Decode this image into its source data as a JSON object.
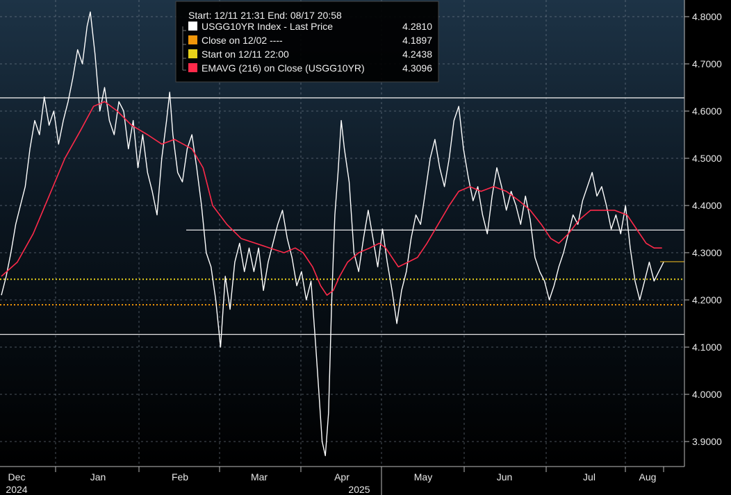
{
  "chart_data": {
    "type": "line",
    "header": "Start: 12/11 21:31 End: 08/17 20:58",
    "x_labels": [
      {
        "month": "Dec",
        "year": "2024"
      },
      {
        "month": "Jan",
        "year": ""
      },
      {
        "month": "Feb",
        "year": ""
      },
      {
        "month": "Mar",
        "year": ""
      },
      {
        "month": "Apr",
        "year": "2025"
      },
      {
        "month": "May",
        "year": ""
      },
      {
        "month": "Jun",
        "year": ""
      },
      {
        "month": "Jul",
        "year": ""
      },
      {
        "month": "Aug",
        "year": ""
      }
    ],
    "y_ticks": [
      "4.8000",
      "4.7000",
      "4.6000",
      "4.5000",
      "4.4000",
      "4.3000",
      "4.2000",
      "4.1000",
      "4.0000",
      "3.9000"
    ],
    "ylim": [
      3.85,
      4.82
    ],
    "legend": [
      {
        "label": "USGG10YR Index - Last Price",
        "value": "4.2810",
        "color": "#ffffff"
      },
      {
        "label": "Close on 12/02 ----",
        "value": "4.1897",
        "color": "#f0960a"
      },
      {
        "label": "Start on 12/11 22:00",
        "value": "4.2438",
        "color": "#e8d21a"
      },
      {
        "label": "EMAVG (216)  on Close (USGG10YR)",
        "value": "4.3096",
        "color": "#ff2a4a"
      }
    ],
    "reference_lines": {
      "horizontal": [
        4.628,
        4.348,
        4.127
      ],
      "close_line": 4.1897,
      "start_line": 4.2438,
      "last_marker": 4.281
    },
    "series": [
      {
        "name": "USGG10YR Index - Last Price",
        "points": [
          [
            0,
            4.21
          ],
          [
            0.3,
            4.25
          ],
          [
            0.6,
            4.3
          ],
          [
            0.9,
            4.36
          ],
          [
            1.2,
            4.4
          ],
          [
            1.5,
            4.44
          ],
          [
            1.8,
            4.52
          ],
          [
            2.1,
            4.58
          ],
          [
            2.4,
            4.55
          ],
          [
            2.7,
            4.63
          ],
          [
            3.0,
            4.57
          ],
          [
            3.3,
            4.6
          ],
          [
            3.6,
            4.53
          ],
          [
            3.9,
            4.58
          ],
          [
            4.2,
            4.62
          ],
          [
            4.5,
            4.67
          ],
          [
            4.8,
            4.73
          ],
          [
            5.1,
            4.7
          ],
          [
            5.4,
            4.78
          ],
          [
            5.6,
            4.81
          ],
          [
            5.9,
            4.72
          ],
          [
            6.2,
            4.6
          ],
          [
            6.5,
            4.65
          ],
          [
            6.8,
            4.58
          ],
          [
            7.1,
            4.55
          ],
          [
            7.4,
            4.62
          ],
          [
            7.7,
            4.6
          ],
          [
            8.0,
            4.52
          ],
          [
            8.3,
            4.58
          ],
          [
            8.6,
            4.48
          ],
          [
            8.9,
            4.55
          ],
          [
            9.2,
            4.47
          ],
          [
            9.5,
            4.43
          ],
          [
            9.8,
            4.38
          ],
          [
            10.1,
            4.5
          ],
          [
            10.4,
            4.58
          ],
          [
            10.6,
            4.64
          ],
          [
            10.8,
            4.55
          ],
          [
            11.1,
            4.47
          ],
          [
            11.4,
            4.45
          ],
          [
            11.7,
            4.52
          ],
          [
            12.0,
            4.55
          ],
          [
            12.3,
            4.48
          ],
          [
            12.6,
            4.4
          ],
          [
            12.9,
            4.3
          ],
          [
            13.2,
            4.27
          ],
          [
            13.5,
            4.2
          ],
          [
            13.8,
            4.1
          ],
          [
            14.1,
            4.25
          ],
          [
            14.4,
            4.18
          ],
          [
            14.7,
            4.28
          ],
          [
            15.0,
            4.32
          ],
          [
            15.3,
            4.26
          ],
          [
            15.6,
            4.31
          ],
          [
            15.9,
            4.26
          ],
          [
            16.2,
            4.31
          ],
          [
            16.5,
            4.22
          ],
          [
            16.8,
            4.28
          ],
          [
            17.1,
            4.32
          ],
          [
            17.4,
            4.36
          ],
          [
            17.7,
            4.39
          ],
          [
            18.0,
            4.33
          ],
          [
            18.3,
            4.29
          ],
          [
            18.6,
            4.23
          ],
          [
            18.9,
            4.26
          ],
          [
            19.2,
            4.2
          ],
          [
            19.5,
            4.24
          ],
          [
            19.8,
            4.1
          ],
          [
            20.0,
            4.0
          ],
          [
            20.2,
            3.9
          ],
          [
            20.4,
            3.87
          ],
          [
            20.6,
            3.96
          ],
          [
            20.8,
            4.2
          ],
          [
            21.0,
            4.38
          ],
          [
            21.2,
            4.47
          ],
          [
            21.4,
            4.58
          ],
          [
            21.6,
            4.52
          ],
          [
            21.9,
            4.45
          ],
          [
            22.2,
            4.3
          ],
          [
            22.5,
            4.26
          ],
          [
            22.8,
            4.33
          ],
          [
            23.1,
            4.39
          ],
          [
            23.4,
            4.33
          ],
          [
            23.7,
            4.27
          ],
          [
            24.0,
            4.35
          ],
          [
            24.3,
            4.28
          ],
          [
            24.6,
            4.22
          ],
          [
            24.9,
            4.15
          ],
          [
            25.2,
            4.22
          ],
          [
            25.5,
            4.26
          ],
          [
            25.8,
            4.33
          ],
          [
            26.1,
            4.38
          ],
          [
            26.4,
            4.36
          ],
          [
            26.7,
            4.43
          ],
          [
            27.0,
            4.5
          ],
          [
            27.3,
            4.54
          ],
          [
            27.6,
            4.48
          ],
          [
            27.9,
            4.44
          ],
          [
            28.2,
            4.5
          ],
          [
            28.5,
            4.58
          ],
          [
            28.8,
            4.61
          ],
          [
            29.1,
            4.52
          ],
          [
            29.4,
            4.46
          ],
          [
            29.7,
            4.41
          ],
          [
            30.0,
            4.44
          ],
          [
            30.3,
            4.38
          ],
          [
            30.6,
            4.34
          ],
          [
            30.9,
            4.42
          ],
          [
            31.2,
            4.48
          ],
          [
            31.5,
            4.44
          ],
          [
            31.8,
            4.39
          ],
          [
            32.1,
            4.43
          ],
          [
            32.4,
            4.4
          ],
          [
            32.7,
            4.36
          ],
          [
            33.0,
            4.42
          ],
          [
            33.3,
            4.37
          ],
          [
            33.6,
            4.29
          ],
          [
            33.9,
            4.26
          ],
          [
            34.2,
            4.24
          ],
          [
            34.5,
            4.2
          ],
          [
            34.8,
            4.23
          ],
          [
            35.1,
            4.27
          ],
          [
            35.4,
            4.3
          ],
          [
            35.7,
            4.34
          ],
          [
            36.0,
            4.38
          ],
          [
            36.3,
            4.36
          ],
          [
            36.6,
            4.41
          ],
          [
            36.9,
            4.44
          ],
          [
            37.2,
            4.47
          ],
          [
            37.5,
            4.42
          ],
          [
            37.8,
            4.44
          ],
          [
            38.1,
            4.4
          ],
          [
            38.4,
            4.35
          ],
          [
            38.7,
            4.38
          ],
          [
            39.0,
            4.34
          ],
          [
            39.3,
            4.4
          ],
          [
            39.6,
            4.31
          ],
          [
            39.9,
            4.24
          ],
          [
            40.2,
            4.2
          ],
          [
            40.5,
            4.24
          ],
          [
            40.8,
            4.28
          ],
          [
            41.1,
            4.24
          ],
          [
            41.4,
            4.26
          ],
          [
            41.7,
            4.28
          ]
        ]
      },
      {
        "name": "EMAVG (216)  on Close (USGG10YR)",
        "points": [
          [
            0,
            4.25
          ],
          [
            1,
            4.28
          ],
          [
            2,
            4.34
          ],
          [
            3,
            4.42
          ],
          [
            4,
            4.5
          ],
          [
            5,
            4.56
          ],
          [
            5.8,
            4.61
          ],
          [
            6.5,
            4.62
          ],
          [
            7.3,
            4.6
          ],
          [
            8.2,
            4.57
          ],
          [
            9.2,
            4.55
          ],
          [
            10.1,
            4.53
          ],
          [
            10.9,
            4.54
          ],
          [
            12.0,
            4.52
          ],
          [
            12.7,
            4.48
          ],
          [
            13.3,
            4.4
          ],
          [
            14.2,
            4.36
          ],
          [
            15.1,
            4.33
          ],
          [
            16.0,
            4.32
          ],
          [
            16.9,
            4.31
          ],
          [
            17.8,
            4.3
          ],
          [
            18.5,
            4.31
          ],
          [
            19.0,
            4.3
          ],
          [
            19.6,
            4.27
          ],
          [
            20.1,
            4.23
          ],
          [
            20.5,
            4.21
          ],
          [
            20.9,
            4.22
          ],
          [
            21.3,
            4.25
          ],
          [
            21.8,
            4.28
          ],
          [
            22.5,
            4.3
          ],
          [
            23.2,
            4.31
          ],
          [
            23.8,
            4.32
          ],
          [
            24.2,
            4.31
          ],
          [
            24.6,
            4.29
          ],
          [
            25.0,
            4.27
          ],
          [
            25.6,
            4.28
          ],
          [
            26.2,
            4.29
          ],
          [
            26.8,
            4.32
          ],
          [
            27.5,
            4.36
          ],
          [
            28.2,
            4.4
          ],
          [
            28.8,
            4.43
          ],
          [
            29.5,
            4.44
          ],
          [
            30.2,
            4.43
          ],
          [
            31.0,
            4.44
          ],
          [
            31.8,
            4.43
          ],
          [
            32.6,
            4.41
          ],
          [
            33.3,
            4.39
          ],
          [
            34.0,
            4.36
          ],
          [
            34.6,
            4.33
          ],
          [
            35.1,
            4.32
          ],
          [
            35.7,
            4.34
          ],
          [
            36.4,
            4.37
          ],
          [
            37.1,
            4.39
          ],
          [
            37.8,
            4.39
          ],
          [
            38.6,
            4.39
          ],
          [
            39.4,
            4.38
          ],
          [
            40.0,
            4.35
          ],
          [
            40.6,
            4.32
          ],
          [
            41.1,
            4.31
          ],
          [
            41.6,
            4.31
          ]
        ]
      }
    ]
  }
}
